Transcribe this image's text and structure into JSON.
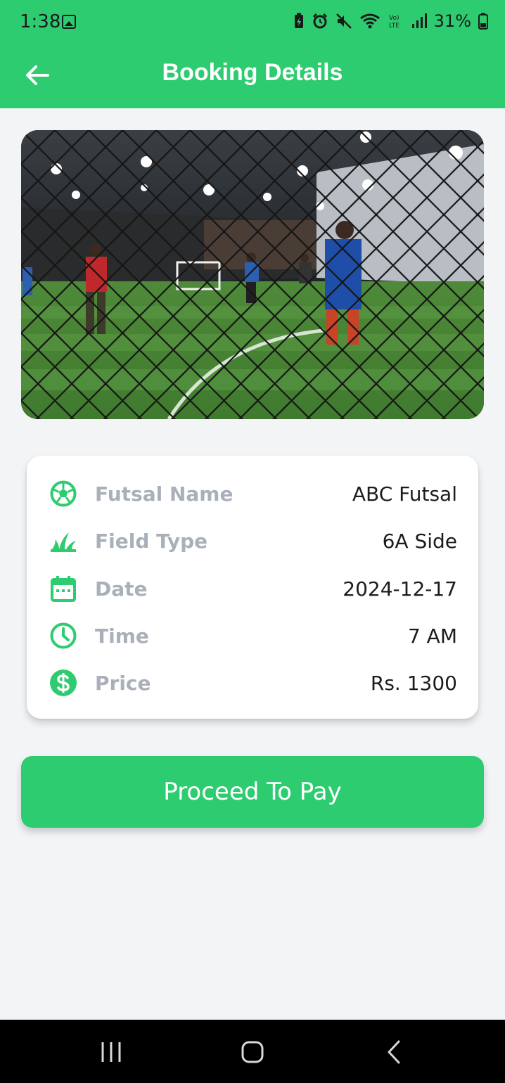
{
  "status_bar": {
    "time": "1:38",
    "battery": "31%",
    "icons": [
      "gallery-icon",
      "battery-saver-icon",
      "alarm-icon",
      "mute-icon",
      "wifi-icon",
      "volte-icon",
      "signal-icon",
      "battery-icon"
    ]
  },
  "header": {
    "title": "Booking Details",
    "back_icon": "arrow-left-icon"
  },
  "hero_image": {
    "subject": "indoor futsal court photo"
  },
  "details": [
    {
      "icon": "soccer-ball-icon",
      "label": "Futsal Name",
      "value": "ABC Futsal"
    },
    {
      "icon": "grass-icon",
      "label": "Field Type",
      "value": "6A Side"
    },
    {
      "icon": "calendar-icon",
      "label": "Date",
      "value": "2024-12-17"
    },
    {
      "icon": "clock-icon",
      "label": "Time",
      "value": "7 AM"
    },
    {
      "icon": "dollar-icon",
      "label": "Price",
      "value": "Rs. 1300"
    }
  ],
  "actions": {
    "pay_label": "Proceed To Pay"
  },
  "colors": {
    "primary": "#2ecc71",
    "background": "#f3f4f6",
    "label": "#a9b0b9",
    "value": "#1c1c1c"
  },
  "nav_bar": {
    "icons": [
      "recent-apps-icon",
      "home-icon",
      "back-icon"
    ]
  }
}
